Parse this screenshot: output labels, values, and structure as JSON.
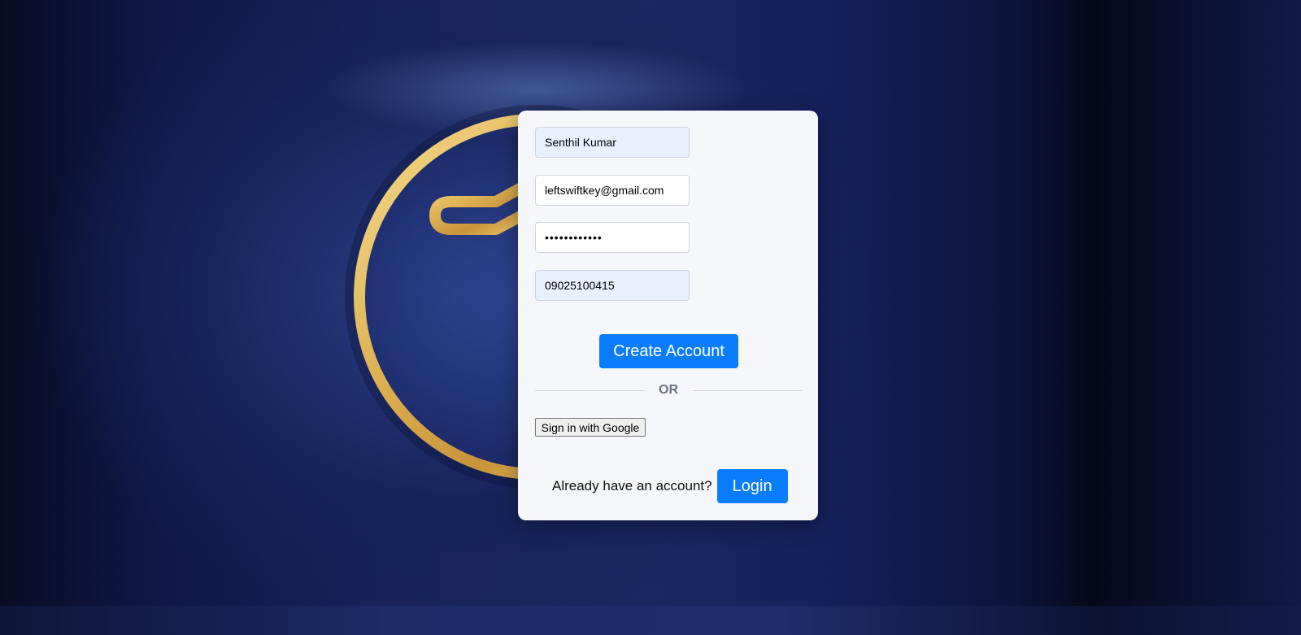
{
  "form": {
    "name_value": "Senthil Kumar",
    "email_value": "leftswiftkey@gmail.com",
    "password_value": "••••••••••••",
    "phone_value": "09025100415"
  },
  "actions": {
    "create_account_label": "Create Account",
    "divider_text": "OR",
    "google_signin_label": "Sign in with Google",
    "login_prompt": "Already have an account?",
    "login_label": "Login"
  },
  "icons": {
    "background_art": "gold-clock-ring-icon"
  },
  "colors": {
    "primary_button": "#0a7cff",
    "card_background": "#f5f7fa",
    "autofill_field": "#e8f0fe",
    "divider_text": "#6b7280",
    "gold": "#e8c46a",
    "background_navy": "#17245a"
  }
}
